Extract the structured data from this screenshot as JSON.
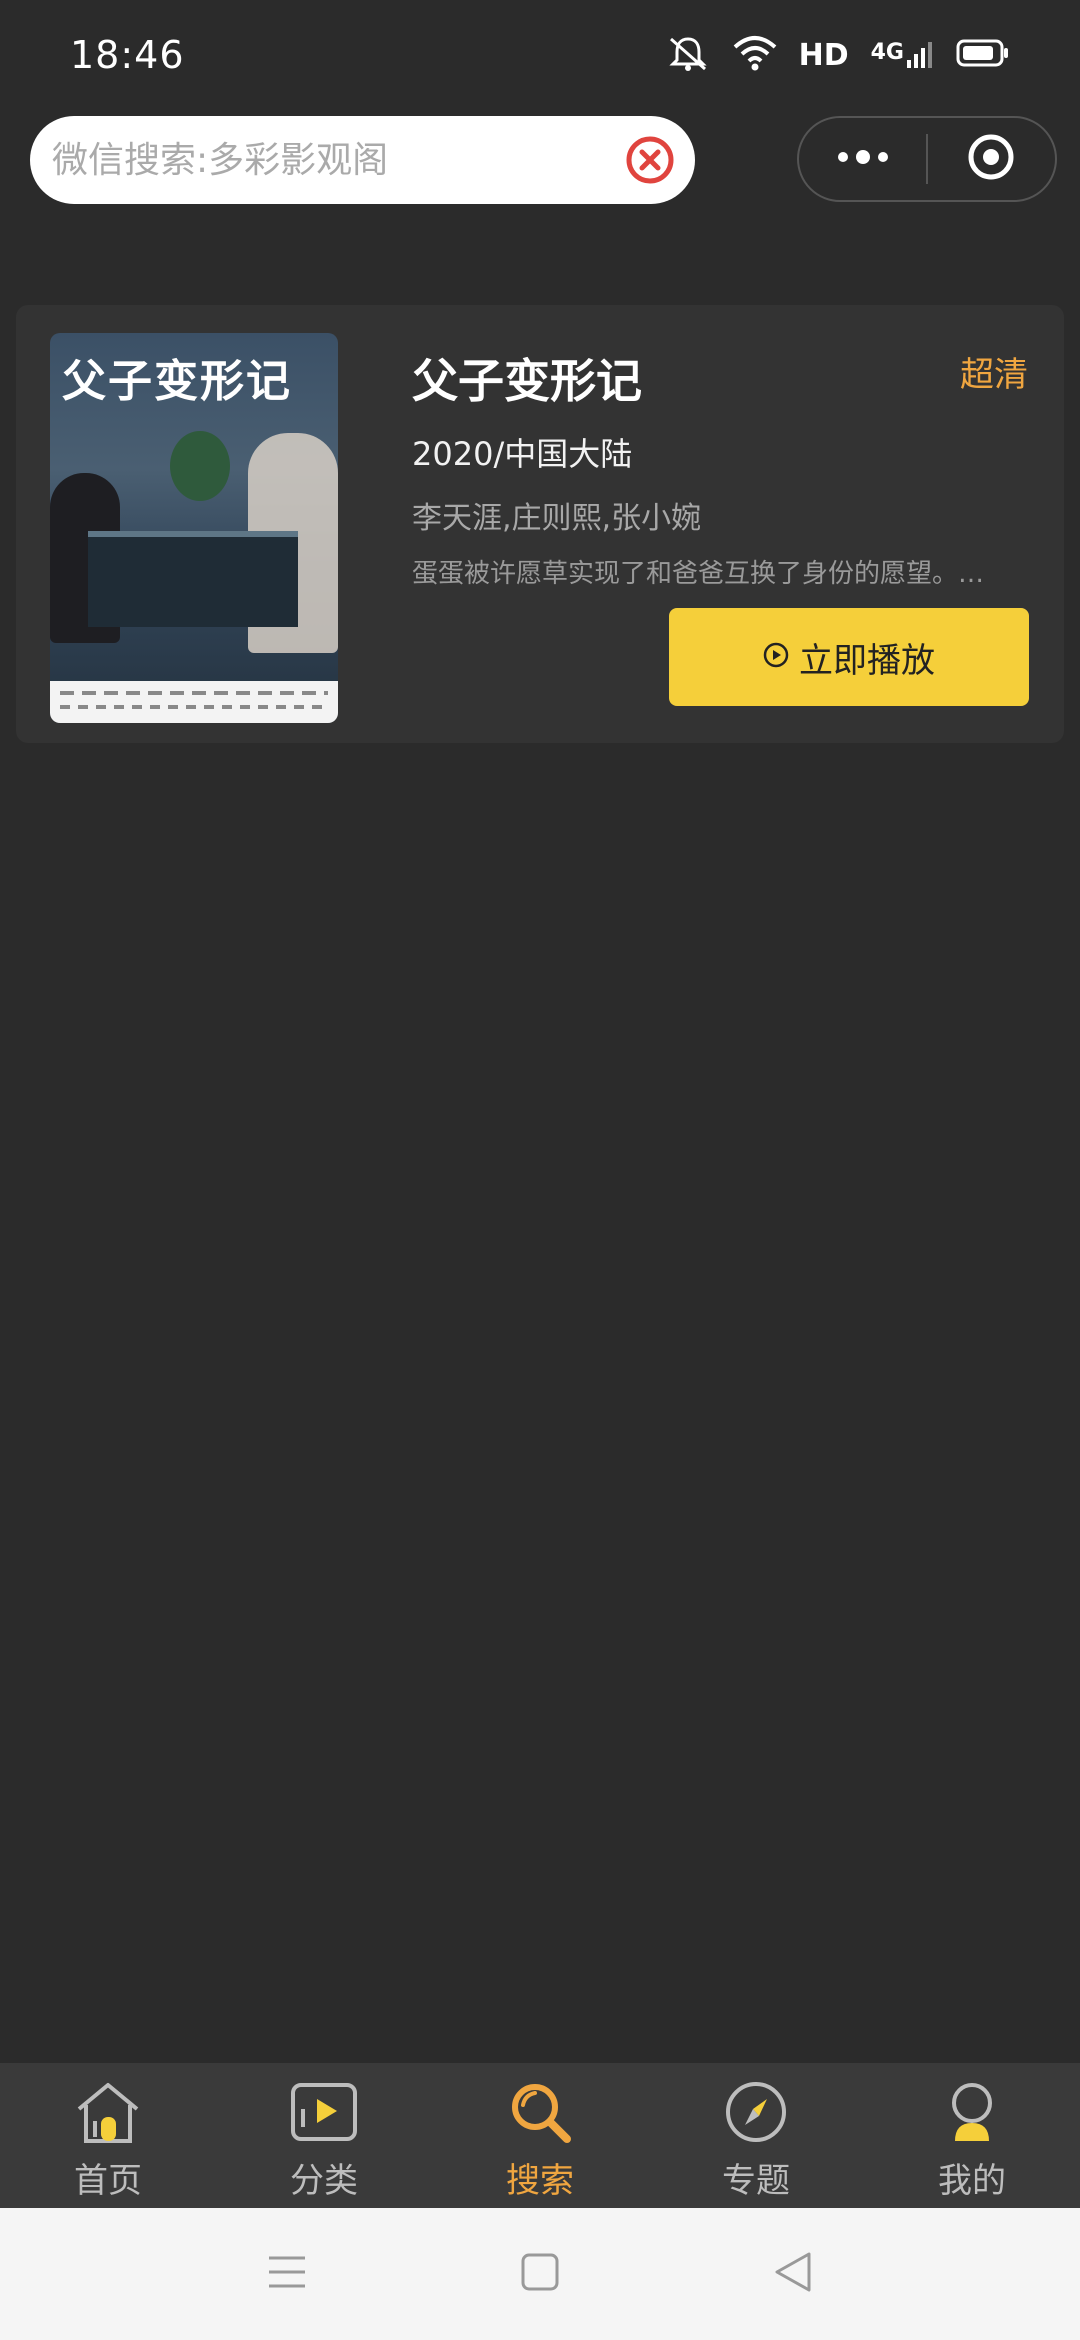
{
  "status_bar": {
    "time": "18:46",
    "hd_label": "HD",
    "network_label": "4G"
  },
  "search": {
    "placeholder": "微信搜索:多彩影观阁"
  },
  "result": {
    "title": "父子变形记",
    "quality": "超清",
    "meta": "2020/中国大陆",
    "cast": "李天涯,庄则熙,张小婉",
    "description": "蛋蛋被许愿草实现了和爸爸互换了身份的愿望。…",
    "play_label": "立即播放",
    "poster_title": "父子变形记"
  },
  "tabs": [
    {
      "label": "首页",
      "icon": "home-icon",
      "active": false
    },
    {
      "label": "分类",
      "icon": "category-icon",
      "active": false
    },
    {
      "label": "搜索",
      "icon": "search-icon",
      "active": true
    },
    {
      "label": "专题",
      "icon": "compass-icon",
      "active": false
    },
    {
      "label": "我的",
      "icon": "profile-icon",
      "active": false
    }
  ],
  "colors": {
    "background": "#2b2b2b",
    "card": "#333333",
    "accent": "#f0a640",
    "play_button": "#f5cf3a",
    "clear_icon": "#e0443e"
  }
}
